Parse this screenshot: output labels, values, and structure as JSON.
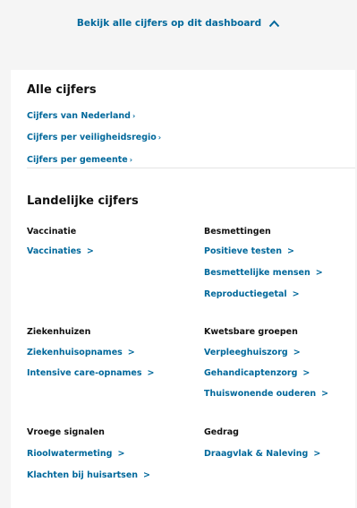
{
  "toggle": {
    "label": "Bekijk alle cijfers op dit dashboard"
  },
  "alle_cijfers": {
    "title": "Alle cijfers",
    "links": [
      {
        "label": "Cijfers van Nederland"
      },
      {
        "label": "Cijfers per veiligheidsregio"
      },
      {
        "label": "Cijfers per gemeente"
      }
    ]
  },
  "landelijk": {
    "title": "Landelijke cijfers",
    "categories": [
      {
        "title": "Vaccinatie",
        "links": [
          {
            "label": "Vaccinaties"
          }
        ]
      },
      {
        "title": "Besmettingen",
        "links": [
          {
            "label": "Positieve testen"
          },
          {
            "label": "Besmettelijke mensen"
          },
          {
            "label": "Reproductiegetal"
          }
        ]
      },
      {
        "title": "Ziekenhuizen",
        "links": [
          {
            "label": "Ziekenhuisopnames"
          },
          {
            "label": "Intensive care-opnames"
          }
        ]
      },
      {
        "title": "Kwetsbare groepen",
        "links": [
          {
            "label": "Verpleeghuiszorg"
          },
          {
            "label": "Gehandicaptenzorg"
          },
          {
            "label": "Thuiswonende ouderen"
          }
        ]
      },
      {
        "title": "Vroege signalen",
        "links": [
          {
            "label": "Rioolwatermeting"
          },
          {
            "label": "Klachten bij huisartsen"
          }
        ]
      },
      {
        "title": "Gedrag",
        "links": [
          {
            "label": "Draagvlak & Naleving"
          }
        ]
      }
    ]
  },
  "colors": {
    "link": "#01689b",
    "text": "#111111",
    "background": "#f5f5f5",
    "panel": "#ffffff"
  },
  "icons": {
    "chevron_up": "chevron-up-icon",
    "chevron_right": "chevron-right-icon"
  }
}
